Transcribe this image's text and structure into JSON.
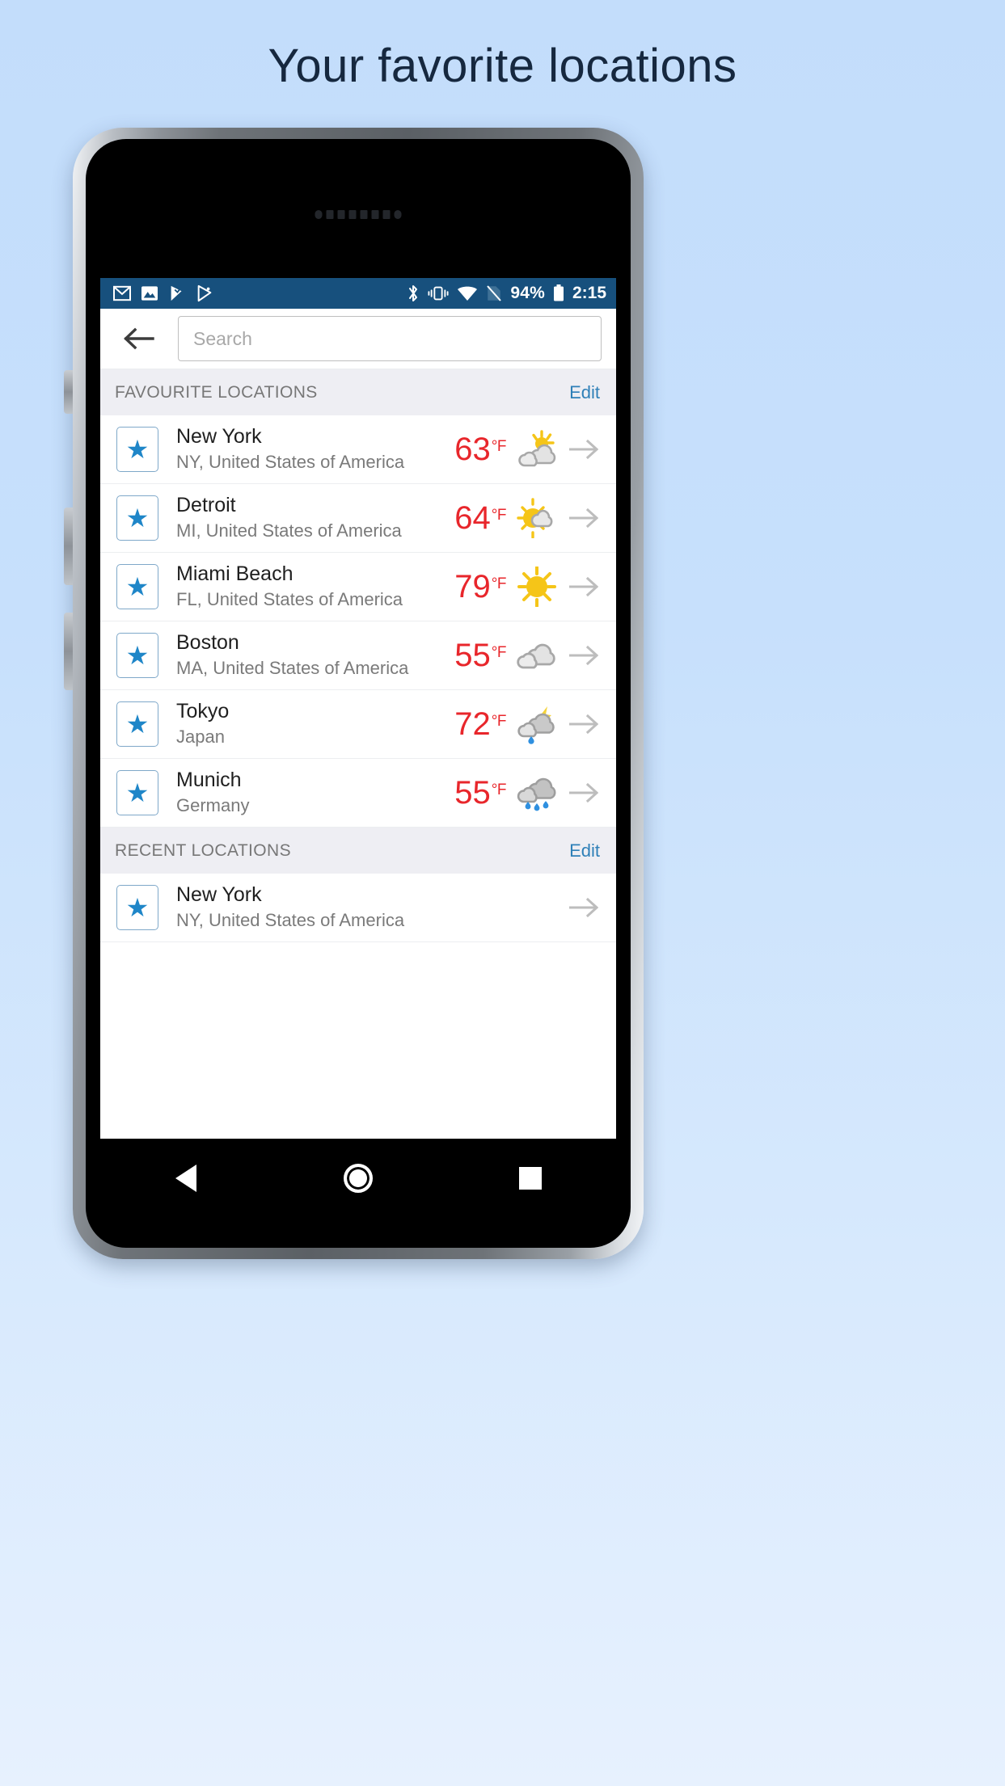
{
  "page": {
    "title": "Your favorite locations"
  },
  "status_bar": {
    "notification_icons": [
      "gmail-icon",
      "photos-icon",
      "play-movies-icon",
      "play-store-icon"
    ],
    "system_icons": [
      "bluetooth-icon",
      "vibrate-icon",
      "wifi-icon",
      "no-sim-icon"
    ],
    "battery_percent": "94%",
    "battery_icon": "battery-full-icon",
    "time": "2:15"
  },
  "app_bar": {
    "back_icon": "back-arrow-icon",
    "search_value": "",
    "search_placeholder": "Search"
  },
  "sections": [
    {
      "title": "FAVOURITE LOCATIONS",
      "edit_label": "Edit",
      "rows": [
        {
          "star_icon": "star-icon",
          "name": "New York",
          "region": "NY, United States of America",
          "temperature": "63",
          "unit": "°F",
          "weather_icon": "sun-behind-cloud-icon",
          "chevron_icon": "arrow-right-icon"
        },
        {
          "star_icon": "star-icon",
          "name": "Detroit",
          "region": "MI, United States of America",
          "temperature": "64",
          "unit": "°F",
          "weather_icon": "sun-small-cloud-icon",
          "chevron_icon": "arrow-right-icon"
        },
        {
          "star_icon": "star-icon",
          "name": "Miami Beach",
          "region": "FL, United States of America",
          "temperature": "79",
          "unit": "°F",
          "weather_icon": "sun-icon",
          "chevron_icon": "arrow-right-icon"
        },
        {
          "star_icon": "star-icon",
          "name": "Boston",
          "region": "MA, United States of America",
          "temperature": "55",
          "unit": "°F",
          "weather_icon": "cloud-icon",
          "chevron_icon": "arrow-right-icon"
        },
        {
          "star_icon": "star-icon",
          "name": "Tokyo",
          "region": "Japan",
          "temperature": "72",
          "unit": "°F",
          "weather_icon": "thunderstorm-rain-icon",
          "chevron_icon": "arrow-right-icon"
        },
        {
          "star_icon": "star-icon",
          "name": "Munich",
          "region": "Germany",
          "temperature": "55",
          "unit": "°F",
          "weather_icon": "rain-cloud-icon",
          "chevron_icon": "arrow-right-icon"
        }
      ]
    },
    {
      "title": "RECENT LOCATIONS",
      "edit_label": "Edit",
      "rows": [
        {
          "star_icon": "star-icon",
          "name": "New York",
          "region": "NY, United States of America",
          "temperature": "",
          "unit": "",
          "weather_icon": "",
          "chevron_icon": "arrow-right-icon"
        }
      ]
    }
  ],
  "nav_bar": {
    "back_icon": "nav-back-triangle-icon",
    "home_icon": "nav-home-circle-icon",
    "recents_icon": "nav-recents-square-icon"
  },
  "colors": {
    "background_top": "#c3ddfb",
    "title_text": "#16283f",
    "status_bar": "#17507d",
    "section_bg": "#eeeef3",
    "edit_link": "#2f80b8",
    "temperature": "#e8262b",
    "star": "#1f86c8"
  }
}
